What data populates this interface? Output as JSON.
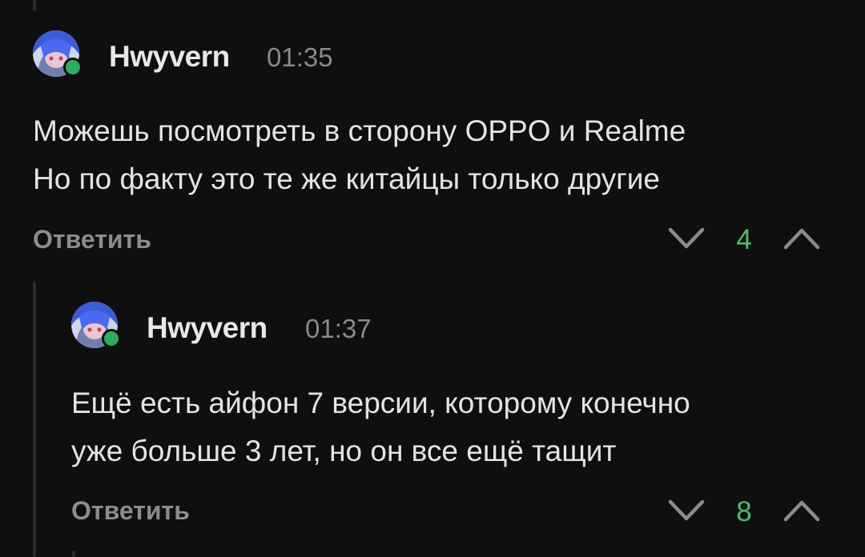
{
  "comments": [
    {
      "author": "Hwyvern",
      "time": "01:35",
      "lines": [
        "Можешь посмотреть в сторону OPPO и Realme",
        "Но по факту это те же китайцы только другие"
      ],
      "reply_label": "Ответить",
      "rating": "4",
      "online": true
    },
    {
      "author": "Hwyvern",
      "time": "01:37",
      "lines": [
        "Ещё есть айфон 7 версии, которому конечно",
        "уже больше 3 лет, но он все ещё тащит"
      ],
      "reply_label": "Ответить",
      "rating": "8",
      "online": true
    }
  ],
  "colors": {
    "background": "#0f0f0f",
    "rating_positive": "#4cbf6a",
    "online": "#2fae5f",
    "muted_text": "#8c8c8c"
  },
  "icons": {
    "vote_down": "chevron-down-icon",
    "vote_up": "chevron-up-icon"
  }
}
